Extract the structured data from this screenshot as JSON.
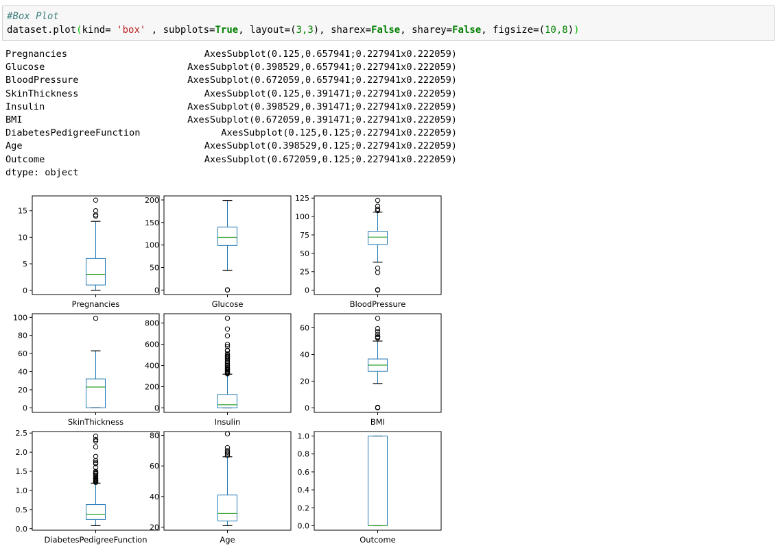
{
  "code": {
    "comment": "#Box Plot",
    "obj": "dataset.plot",
    "args_a": "kind= ",
    "kind_value": "'box'",
    "args_b": " , subplots=",
    "subplots_value": "True",
    "args_c": ", layout=",
    "layout_value": "3,3",
    "args_d": ", sharex=",
    "sharex_value": "False",
    "args_e": ", sharey=",
    "sharey_value": "False",
    "args_f": ", figsize=",
    "figsize_value": "10,8"
  },
  "output": {
    "rows": [
      {
        "name": "Pregnancies",
        "value": "AxesSubplot(0.125,0.657941;0.227941x0.222059)"
      },
      {
        "name": "Glucose",
        "value": "AxesSubplot(0.398529,0.657941;0.227941x0.222059)"
      },
      {
        "name": "BloodPressure",
        "value": "AxesSubplot(0.672059,0.657941;0.227941x0.222059)"
      },
      {
        "name": "SkinThickness",
        "value": "AxesSubplot(0.125,0.391471;0.227941x0.222059)"
      },
      {
        "name": "Insulin",
        "value": "AxesSubplot(0.398529,0.391471;0.227941x0.222059)"
      },
      {
        "name": "BMI",
        "value": "AxesSubplot(0.672059,0.391471;0.227941x0.222059)"
      },
      {
        "name": "DiabetesPedigreeFunction",
        "value": "AxesSubplot(0.125,0.125;0.227941x0.222059)"
      },
      {
        "name": "Age",
        "value": "AxesSubplot(0.398529,0.125;0.227941x0.222059)"
      },
      {
        "name": "Outcome",
        "value": "AxesSubplot(0.672059,0.125;0.227941x0.222059)"
      }
    ],
    "dtype": "dtype: object"
  },
  "colors": {
    "box": "#1f77b4",
    "median": "#2ca02c",
    "whisker": "#000000",
    "axes": "#000000"
  },
  "chart_data": [
    {
      "type": "box",
      "xlabel": "Pregnancies",
      "ylim": [
        -0.8,
        17.8
      ],
      "yticks": [
        0,
        5,
        10,
        15
      ],
      "tick_labels": [
        "0",
        "5",
        "10",
        "15"
      ],
      "min": 0,
      "q1": 1,
      "median": 3,
      "q3": 6,
      "max": 13,
      "outliers": [
        14,
        14.2,
        15,
        17
      ]
    },
    {
      "type": "box",
      "xlabel": "Glucose",
      "ylim": [
        -10,
        209
      ],
      "yticks": [
        0,
        50,
        100,
        150,
        200
      ],
      "tick_labels": [
        "0",
        "50",
        "100",
        "150",
        "200"
      ],
      "min": 44,
      "q1": 99,
      "median": 117,
      "q3": 140,
      "max": 199,
      "outliers": [
        0,
        0.5
      ]
    },
    {
      "type": "box",
      "xlabel": "BloodPressure",
      "ylim": [
        -6,
        128
      ],
      "yticks": [
        0,
        25,
        50,
        75,
        100,
        125
      ],
      "tick_labels": [
        "0",
        "25",
        "50",
        "75",
        "100",
        "125"
      ],
      "min": 38,
      "q1": 62,
      "median": 72,
      "q3": 80,
      "max": 106,
      "outliers": [
        0,
        0.6,
        24,
        30,
        108,
        110,
        114,
        122
      ]
    },
    {
      "type": "box",
      "xlabel": "SkinThickness",
      "ylim": [
        -5,
        104
      ],
      "yticks": [
        0,
        20,
        40,
        60,
        80,
        100
      ],
      "tick_labels": [
        "0",
        "20",
        "40",
        "60",
        "80",
        "100"
      ],
      "min": 0,
      "q1": 0,
      "median": 23,
      "q3": 32,
      "max": 63,
      "outliers": [
        99
      ]
    },
    {
      "type": "box",
      "xlabel": "Insulin",
      "ylim": [
        -42,
        888
      ],
      "yticks": [
        0,
        200,
        400,
        600,
        800
      ],
      "tick_labels": [
        "0",
        "200",
        "400",
        "600",
        "800"
      ],
      "min": 0,
      "q1": 0,
      "median": 30,
      "q3": 127,
      "max": 318,
      "outliers": [
        321,
        328,
        335,
        342,
        350,
        360,
        370,
        380,
        392,
        402,
        415,
        430,
        440,
        455,
        465,
        480,
        485,
        495,
        510,
        540,
        545,
        580,
        600,
        680,
        744,
        846
      ]
    },
    {
      "type": "box",
      "xlabel": "BMI",
      "ylim": [
        -3.4,
        70.5
      ],
      "yticks": [
        0,
        20,
        40,
        60
      ],
      "tick_labels": [
        "0",
        "20",
        "40",
        "60"
      ],
      "min": 18.2,
      "q1": 27.3,
      "median": 32,
      "q3": 36.6,
      "max": 50,
      "outliers": [
        0,
        0.4,
        52.3,
        52.9,
        53.2,
        55,
        57.3,
        59.4,
        67.1
      ]
    },
    {
      "type": "box",
      "xlabel": "DiabetesPedigreeFunction",
      "ylim": [
        -0.04,
        2.54
      ],
      "yticks": [
        0.0,
        0.5,
        1.0,
        1.5,
        2.0,
        2.5
      ],
      "tick_labels": [
        "0.0",
        "0.5",
        "1.0",
        "1.5",
        "2.0",
        "2.5"
      ],
      "min": 0.078,
      "q1": 0.24,
      "median": 0.37,
      "q3": 0.63,
      "max": 1.19,
      "outliers": [
        1.21,
        1.22,
        1.25,
        1.26,
        1.28,
        1.3,
        1.32,
        1.35,
        1.39,
        1.4,
        1.44,
        1.46,
        1.47,
        1.5,
        1.6,
        1.7,
        1.73,
        1.78,
        1.89,
        2.14,
        2.29,
        2.33,
        2.42
      ]
    },
    {
      "type": "box",
      "xlabel": "Age",
      "ylim": [
        18,
        82.5
      ],
      "yticks": [
        20,
        40,
        60,
        80
      ],
      "tick_labels": [
        "20",
        "40",
        "60",
        "80"
      ],
      "min": 21,
      "q1": 24,
      "median": 29,
      "q3": 41,
      "max": 66,
      "outliers": [
        67,
        68,
        69,
        70,
        72,
        81
      ]
    },
    {
      "type": "box",
      "xlabel": "Outcome",
      "ylim": [
        -0.05,
        1.05
      ],
      "yticks": [
        0.0,
        0.2,
        0.4,
        0.6,
        0.8,
        1.0
      ],
      "tick_labels": [
        "0.0",
        "0.2",
        "0.4",
        "0.6",
        "0.8",
        "1.0"
      ],
      "min": 0,
      "q1": 0,
      "median": 0,
      "q3": 1,
      "max": 1,
      "outliers": []
    }
  ]
}
